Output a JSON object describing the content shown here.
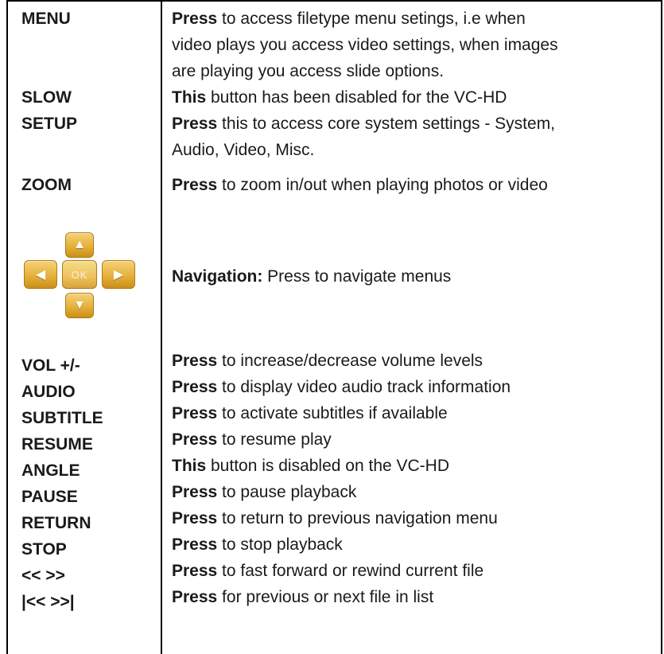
{
  "rows": [
    {
      "key": "MENU",
      "lines": [
        {
          "bold": "Press",
          "text": " to access filetype menu setings, i.e when"
        },
        {
          "bold": "",
          "text": "video plays you access video settings, when images"
        },
        {
          "bold": "",
          "text": "are playing you access slide options."
        }
      ]
    },
    {
      "key": "SLOW",
      "lines": [
        {
          "bold": "This",
          "text": " button has been disabled for the VC-HD"
        }
      ]
    },
    {
      "key": "SETUP",
      "lines": [
        {
          "bold": "Press",
          "text": " this to access core system settings - System,"
        },
        {
          "bold": "",
          "text": "Audio, Video, Misc."
        }
      ]
    },
    {
      "key": "ZOOM",
      "lines": [
        {
          "bold": "Press",
          "text": " to zoom in/out when playing photos or video"
        }
      ]
    },
    {
      "key": "",
      "lines": [
        {
          "bold": "Navigation:",
          "text": " Press to navigate menus"
        }
      ]
    },
    {
      "key": "VOL +/-",
      "lines": [
        {
          "bold": "Press",
          "text": " to increase/decrease volume levels"
        }
      ]
    },
    {
      "key": "AUDIO",
      "lines": [
        {
          "bold": "Press",
          "text": " to display video audio track information"
        }
      ]
    },
    {
      "key": "SUBTITLE",
      "lines": [
        {
          "bold": "Press",
          "text": " to activate subtitles if available"
        }
      ]
    },
    {
      "key": "RESUME",
      "lines": [
        {
          "bold": "Press",
          "text": " to resume play"
        }
      ]
    },
    {
      "key": "ANGLE",
      "lines": [
        {
          "bold": "This",
          "text": " button is disabled on the VC-HD"
        }
      ]
    },
    {
      "key": "PAUSE",
      "lines": [
        {
          "bold": "Press",
          "text": " to pause playback"
        }
      ]
    },
    {
      "key": "RETURN",
      "lines": [
        {
          "bold": "Press",
          "text": " to return to previous navigation menu"
        }
      ]
    },
    {
      "key": "STOP",
      "lines": [
        {
          "bold": "Press",
          "text": " to stop playback"
        }
      ]
    },
    {
      "key": "<< >>",
      "lines": [
        {
          "bold": "Press",
          "text": " to fast forward or rewind current file"
        }
      ]
    },
    {
      "key": "|<< >>|",
      "lines": [
        {
          "bold": "Press",
          "text": " for previous or next file in list"
        }
      ]
    }
  ],
  "dpad": {
    "up": "▲",
    "down": "▼",
    "left": "◀",
    "right": "▶",
    "ok": "OK",
    "colors": {
      "key_light": "#f4d27a",
      "key_mid": "#e6b13a",
      "key_dark": "#c98f1a"
    }
  }
}
